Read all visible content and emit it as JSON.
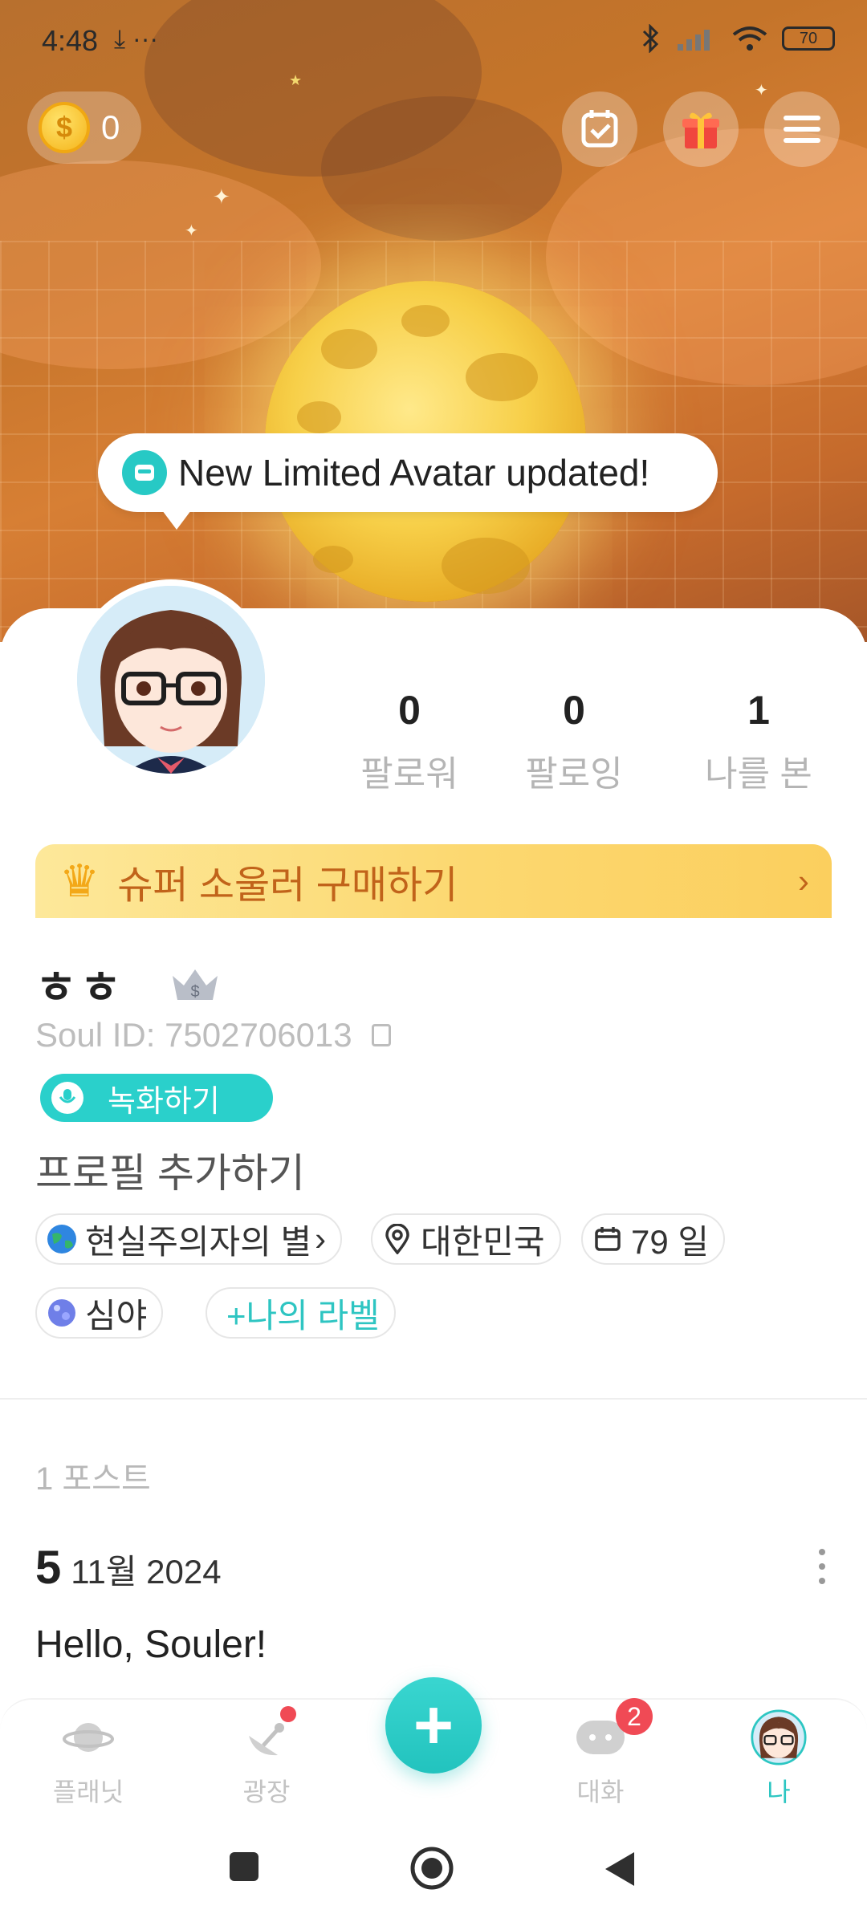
{
  "status_bar": {
    "time": "4:48",
    "extra_icons": "⤓ ···",
    "battery": "70"
  },
  "header": {
    "coin_count": "0",
    "icons": [
      "calendar-check-icon",
      "gift-icon",
      "menu-icon"
    ]
  },
  "announcement": {
    "text": "New Limited Avatar updated!"
  },
  "stats": [
    {
      "value": "0",
      "label": "팔로워"
    },
    {
      "value": "0",
      "label": "팔로잉"
    },
    {
      "value": "1",
      "label": "나를 본"
    }
  ],
  "super_banner": {
    "text": "슈퍼 소울러 구매하기",
    "chevron": "›"
  },
  "profile": {
    "name": "ㅎㅎ",
    "soul_id": "Soul ID: 7502706013",
    "record_button": "녹화하기",
    "add_profile": "프로필 추가하기"
  },
  "tags": [
    {
      "text": "현실주의자의 별",
      "suffix": "›",
      "icon": "globe-icon"
    },
    {
      "text": "대한민국",
      "icon": "location-pin-icon"
    },
    {
      "text": "79 일",
      "icon": "calendar-icon"
    },
    {
      "text": "심야",
      "icon": "planet-icon"
    },
    {
      "text": "+나의 라벨",
      "icon": ""
    }
  ],
  "posts": {
    "count_label": "1 포스트",
    "items": [
      {
        "day": "5",
        "month_year": "11월 2024",
        "text": "Hello, Souler!"
      }
    ]
  },
  "bottom_nav": {
    "items": [
      {
        "label": "플래닛",
        "icon": "planet-icon"
      },
      {
        "label": "광장",
        "icon": "satellite-icon"
      },
      {
        "label": "대화",
        "icon": "chat-icon",
        "badge": "2"
      },
      {
        "label": "나",
        "icon": "avatar-icon",
        "active": true
      }
    ],
    "fab": "+"
  },
  "colors": {
    "accent": "#2ac9c4",
    "badge": "#f04a55",
    "banner_text": "#c1631a"
  }
}
